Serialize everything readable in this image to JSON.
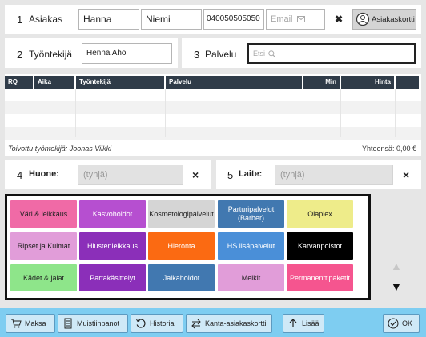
{
  "customer": {
    "number": "1",
    "label": "Asiakas",
    "first_name": "Hanna",
    "last_name": "Niemi",
    "phone": "040050505050",
    "email_placeholder": "Email",
    "clear": "✖",
    "card_button": "Asiakaskortti"
  },
  "employee": {
    "number": "2",
    "label": "Työntekijä",
    "value": "Henna Aho"
  },
  "service": {
    "number": "3",
    "label": "Palvelu",
    "search_placeholder": "Etsi"
  },
  "table": {
    "columns": [
      "RQ",
      "Aika",
      "Työntekijä",
      "Palvelu",
      "Min",
      "Hinta"
    ],
    "footer_left": "Toivottu työntekijä: Joonas Viikki",
    "footer_right": "Yhteensä: 0,00 €"
  },
  "room": {
    "number": "4",
    "label": "Huone:",
    "value": "(tyhjä)",
    "clear": "×"
  },
  "device": {
    "number": "5",
    "label": "Laite:",
    "value": "(tyhjä)",
    "clear": "×"
  },
  "services": [
    {
      "label": "Väri & leikkaus",
      "color": "#f06aa6",
      "text_color": "#222"
    },
    {
      "label": "Kasvohoidot",
      "color": "#b64fd0",
      "text_color": "#fff"
    },
    {
      "label": "Kosmetologipalvelut",
      "color": "#d5d5d5",
      "text_color": "#222"
    },
    {
      "label": "Parturipalvelut (Barber)",
      "color": "#4178b0",
      "text_color": "#fff"
    },
    {
      "label": "Olaplex",
      "color": "#eeec8a",
      "text_color": "#222"
    },
    {
      "label": "Ripset ja Kulmat",
      "color": "#e19dd9",
      "text_color": "#222"
    },
    {
      "label": "Hiustenleikkaus",
      "color": "#8b2fb9",
      "text_color": "#fff"
    },
    {
      "label": "Hieronta",
      "color": "#fb6a12",
      "text_color": "#fff"
    },
    {
      "label": "HS lisäpalvelut",
      "color": "#4a8fd8",
      "text_color": "#fff"
    },
    {
      "label": "Karvanpoistot",
      "color": "#000000",
      "text_color": "#fff"
    },
    {
      "label": "Kädet & jalat",
      "color": "#8ee58a",
      "text_color": "#222"
    },
    {
      "label": "Partakäsittelyt",
      "color": "#8b2fb9",
      "text_color": "#fff"
    },
    {
      "label": "Jalkahoidot",
      "color": "#4178b0",
      "text_color": "#fff"
    },
    {
      "label": "Meikit",
      "color": "#e19dd9",
      "text_color": "#222"
    },
    {
      "label": "Permanenttipaketit",
      "color": "#f5558f",
      "text_color": "#fff"
    }
  ],
  "scroll": {
    "up": "▲",
    "down": "▼"
  },
  "bottom_bar": {
    "pay": "Maksa",
    "notes": "Muistiinpanot",
    "history": "Historia",
    "loyalty_card": "Kanta-asiakaskortti",
    "more": "Lisää",
    "ok": "OK"
  }
}
